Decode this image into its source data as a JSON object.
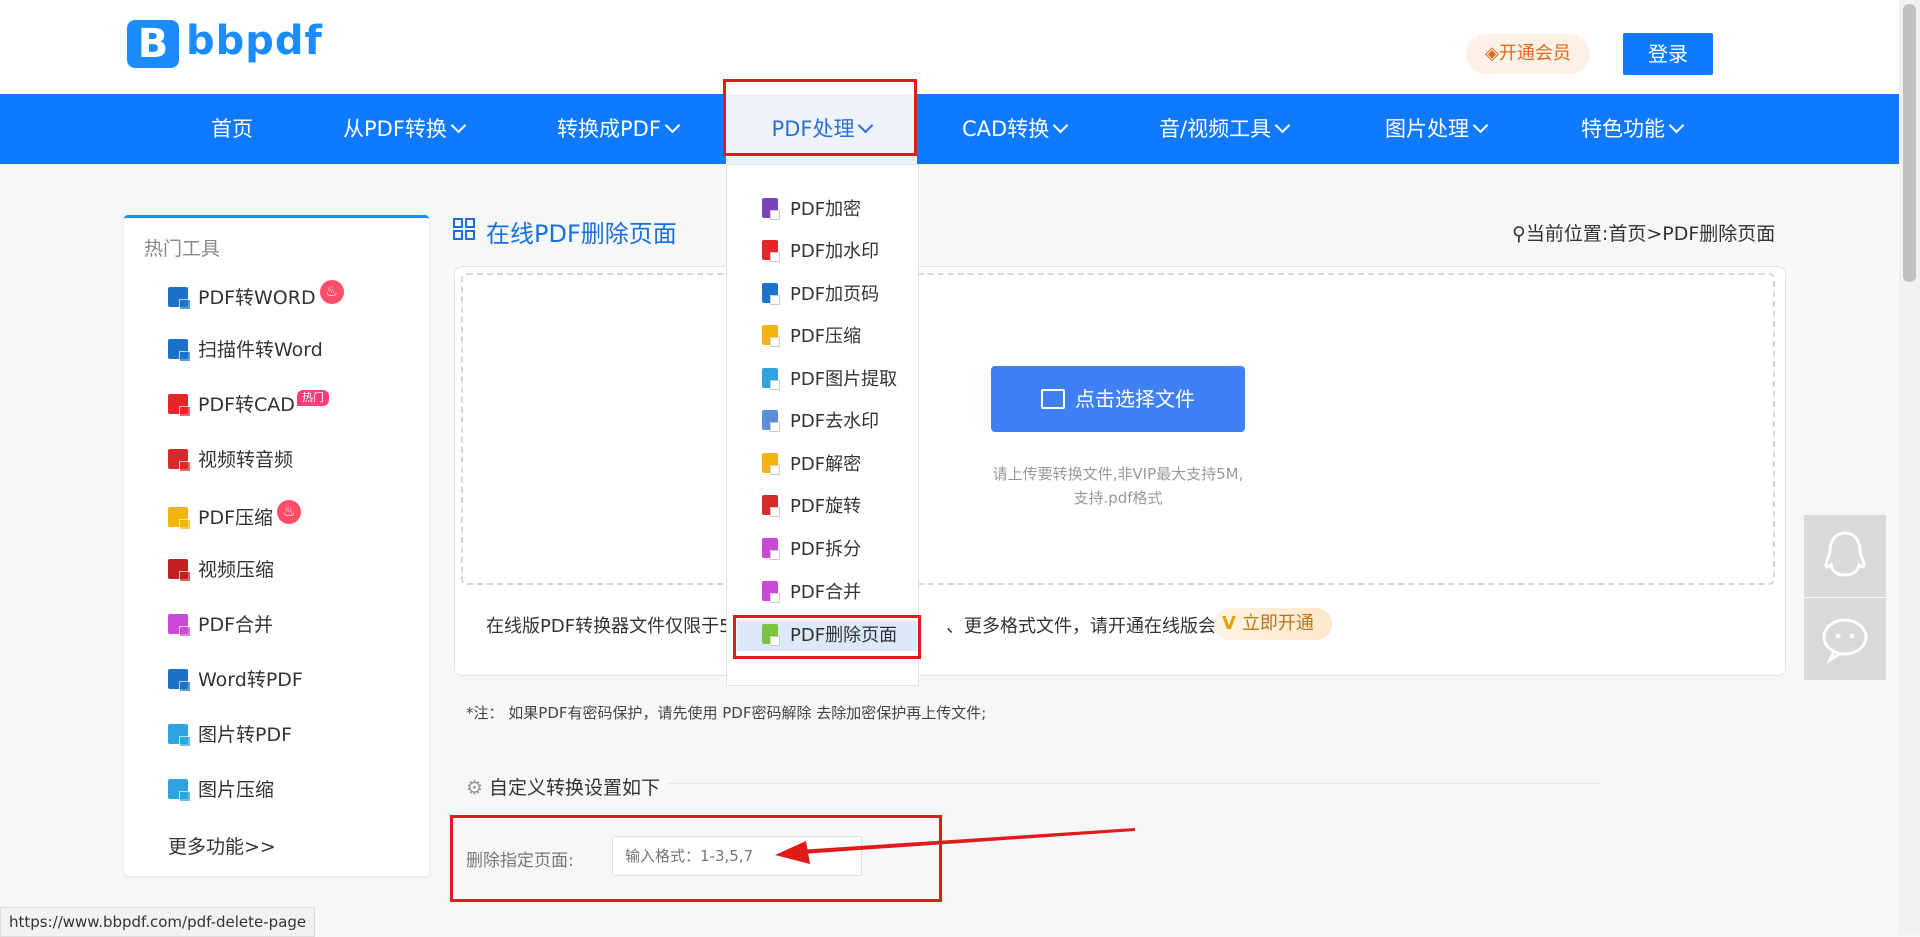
{
  "header": {
    "logo_letter": "B",
    "logo_text": "bbpdf",
    "vip_label": "开通会员",
    "login_label": "登录"
  },
  "nav": {
    "items": [
      {
        "label": "首页"
      },
      {
        "label": "从PDF转换"
      },
      {
        "label": "转换成PDF"
      },
      {
        "label": "PDF处理"
      },
      {
        "label": "CAD转换"
      },
      {
        "label": "音/视频工具"
      },
      {
        "label": "图片处理"
      },
      {
        "label": "特色功能"
      }
    ],
    "active_index": 3
  },
  "dropdown": {
    "items": [
      {
        "label": "PDF加密",
        "color": "#7a45b8"
      },
      {
        "label": "PDF加水印",
        "color": "#e8242c"
      },
      {
        "label": "PDF加页码",
        "color": "#1a73c9"
      },
      {
        "label": "PDF压缩",
        "color": "#f6b40e"
      },
      {
        "label": "PDF图片提取",
        "color": "#2ea3e0"
      },
      {
        "label": "PDF去水印",
        "color": "#5a8fd8"
      },
      {
        "label": "PDF解密",
        "color": "#f6b40e"
      },
      {
        "label": "PDF旋转",
        "color": "#d92a2a"
      },
      {
        "label": "PDF拆分",
        "color": "#c94ad6"
      },
      {
        "label": "PDF合并",
        "color": "#c94ad6"
      },
      {
        "label": "PDF删除页面",
        "color": "#7cc23c"
      }
    ],
    "selected_index": 10
  },
  "sidebar": {
    "title": "热门工具",
    "items": [
      {
        "label": "PDF转WORD",
        "color": "#1a73c9",
        "badge": "fire"
      },
      {
        "label": "扫描件转Word",
        "color": "#1a73c9",
        "badge": ""
      },
      {
        "label": "PDF转CAD",
        "color": "#e8242c",
        "badge": "hot",
        "badge_text": "热门"
      },
      {
        "label": "视频转音频",
        "color": "#d92a2a",
        "badge": ""
      },
      {
        "label": "PDF压缩",
        "color": "#f6b40e",
        "badge": "fire"
      },
      {
        "label": "视频压缩",
        "color": "#c41e1e",
        "badge": ""
      },
      {
        "label": "PDF合并",
        "color": "#c94ad6",
        "badge": ""
      },
      {
        "label": "Word转PDF",
        "color": "#1a73c9",
        "badge": ""
      },
      {
        "label": "图片转PDF",
        "color": "#2ea3e0",
        "badge": ""
      },
      {
        "label": "图片压缩",
        "color": "#2ea3e0",
        "badge": ""
      }
    ],
    "more_label": "更多功能>>"
  },
  "main": {
    "page_title": "在线PDF删除页面",
    "breadcrumb": "当前位置:首页>PDF删除页面",
    "select_button": "点击选择文件",
    "hint_line1": "请上传要转换文件,非VIP最大支持5M,",
    "hint_line2": "支持.pdf格式",
    "notice_prefix": "在线版PDF转换器文件仅限于5M",
    "notice_suffix": "、更多格式文件，请开通在线版会员",
    "vip_open_label": "立即开通",
    "note_prefix": "*注： 如果PDF有密码保护，请先使用 ",
    "note_link": "PDF密码解除",
    "note_suffix": " 去除加密保护再上传文件;",
    "settings_title": "自定义转换设置如下",
    "delete_pages_label": "删除指定页面:",
    "delete_pages_placeholder": "输入格式：1-3,5,7"
  },
  "status_bar": {
    "url": "https://www.bbpdf.com/pdf-delete-page"
  },
  "colors": {
    "nav_blue": "#0f7aff",
    "accent_blue": "#3f80f5",
    "annotation_red": "#e11a1a"
  }
}
